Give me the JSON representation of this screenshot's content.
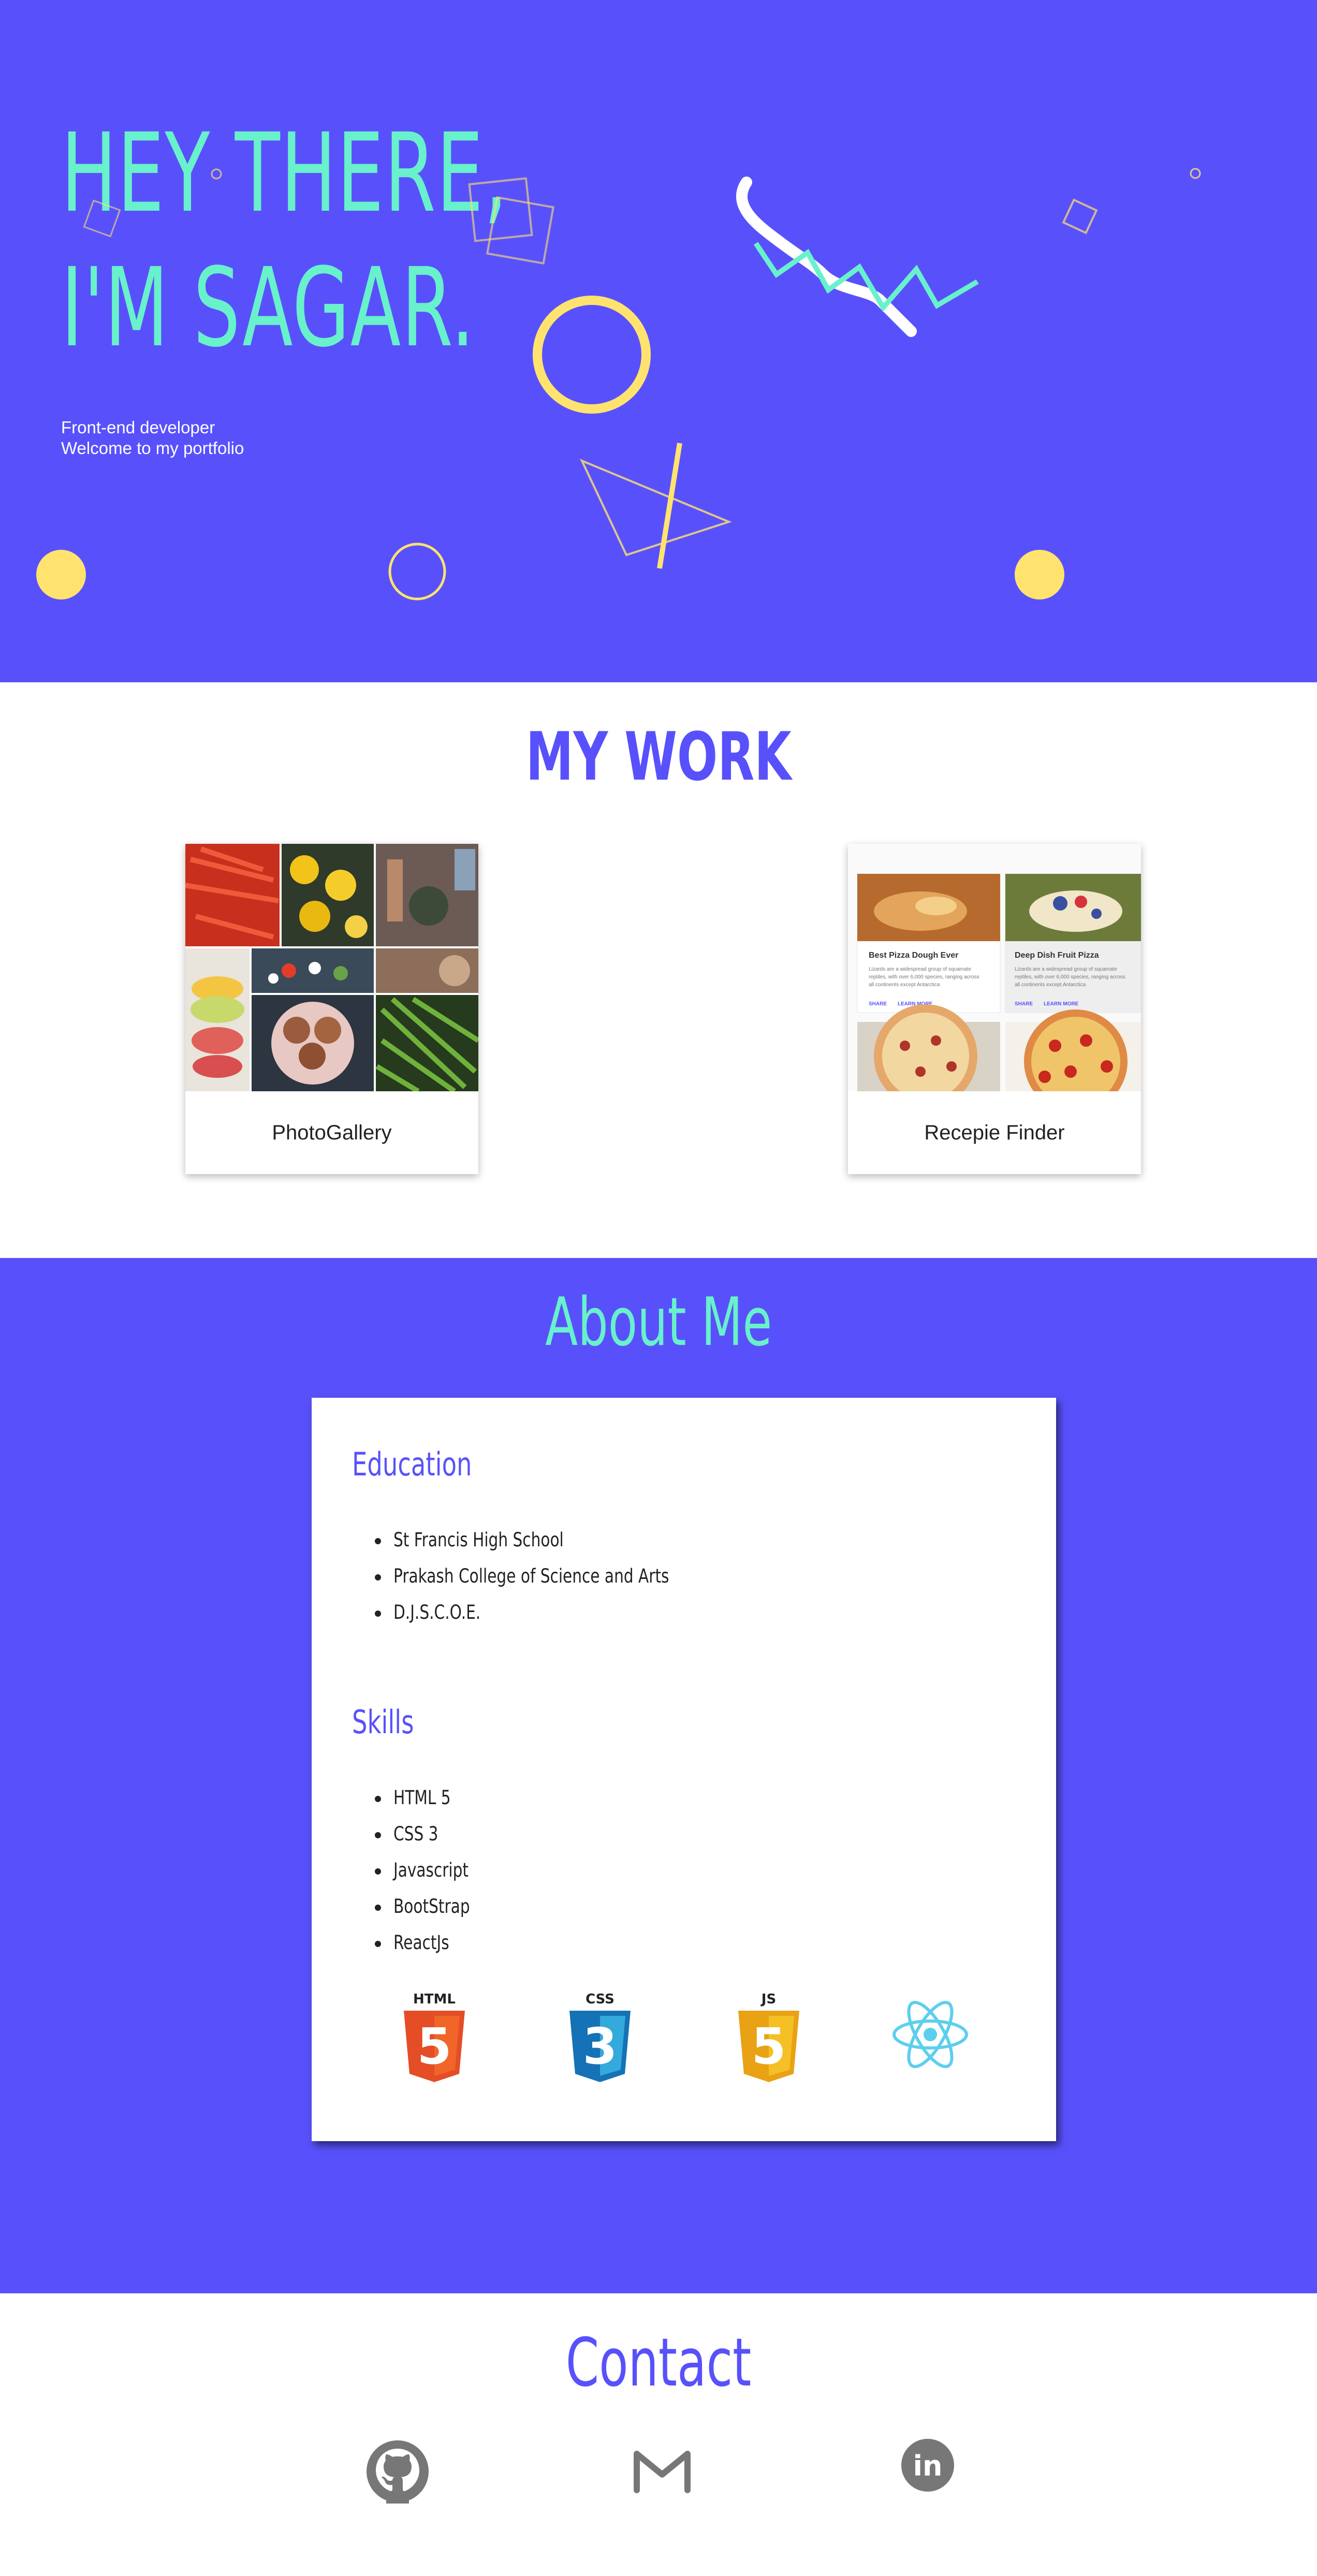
{
  "hero": {
    "title_line1": "HEY THERE,",
    "title_line2": "I'M SAGAR.",
    "subtitle_line1": "Front-end developer",
    "subtitle_line2": "Welcome to my portfolio"
  },
  "work": {
    "title": "MY WORK",
    "projects": [
      {
        "label": "PhotoGallery"
      },
      {
        "label": "Recepie Finder",
        "preview": {
          "card1_title": "Best Pizza Dough Ever",
          "card2_title": "Deep Dish Fruit Pizza",
          "card_text": "Lizards are a widespread group of squamate reptiles, with over 6,000 species, ranging across all continents except Antarctica",
          "share": "SHARE",
          "learn_more": "LEARN MORE"
        }
      }
    ]
  },
  "about": {
    "title": "About Me",
    "education": {
      "heading": "Education",
      "items": [
        "St Francis High School",
        "Prakash College of Science and Arts",
        "D.J.S.C.O.E."
      ]
    },
    "skills": {
      "heading": "Skills",
      "items": [
        "HTML 5",
        "CSS 3",
        "Javascript",
        "BootStrap",
        "ReactJs"
      ],
      "icons": [
        {
          "icon": "html5-icon",
          "label": "HTML",
          "glyph": "5",
          "color": "#e44d26"
        },
        {
          "icon": "css3-icon",
          "label": "CSS",
          "glyph": "3",
          "color": "#1572b6"
        },
        {
          "icon": "js-icon",
          "label": "JS",
          "glyph": "5",
          "color": "#f0a30a"
        },
        {
          "icon": "react-icon",
          "color": "#5ccfee"
        }
      ]
    }
  },
  "contact": {
    "title": "Contact",
    "links": [
      {
        "icon": "github-icon"
      },
      {
        "icon": "gmail-icon"
      },
      {
        "icon": "linkedin-icon",
        "label": "in"
      }
    ]
  },
  "colors": {
    "brand_purple": "#5851fb",
    "mint": "#68f1cb",
    "yellow": "#ffe36e",
    "icon_gray": "#777777"
  }
}
